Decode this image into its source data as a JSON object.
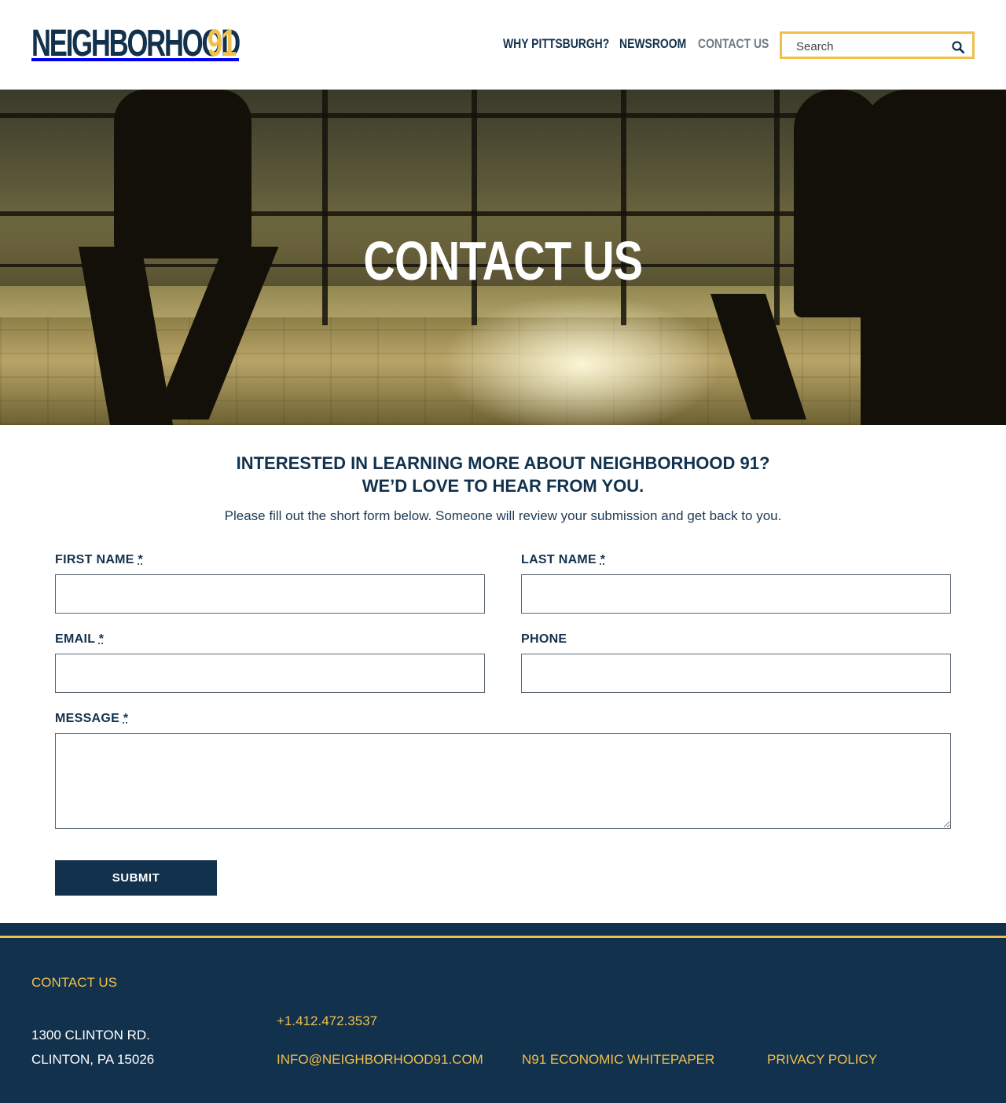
{
  "header": {
    "logo_text": "NEIGHBORHOOD",
    "logo_number": "91",
    "nav": [
      {
        "label": "WHY PITTSBURGH?"
      },
      {
        "label": "NEWSROOM"
      },
      {
        "label": "CONTACT US"
      }
    ],
    "search": {
      "placeholder": "Search",
      "value": ""
    }
  },
  "hero": {
    "title": "CONTACT US"
  },
  "intro": {
    "heading_line1": "INTERESTED IN LEARNING MORE ABOUT NEIGHBORHOOD 91?",
    "heading_line2": "WE’D LOVE TO HEAR FROM YOU.",
    "text": "Please fill out the short form below. Someone will review your submission and get back to you."
  },
  "form": {
    "first_name": {
      "label": "FIRST NAME",
      "required_mark": "*",
      "value": ""
    },
    "last_name": {
      "label": "LAST NAME",
      "required_mark": "*",
      "value": ""
    },
    "email": {
      "label": "EMAIL",
      "required_mark": "*",
      "value": ""
    },
    "phone": {
      "label": "PHONE",
      "value": ""
    },
    "message": {
      "label": "MESSAGE",
      "required_mark": "*",
      "value": ""
    },
    "submit_label": "SUBMIT"
  },
  "footer": {
    "title": "CONTACT US",
    "address_line1": "1300 CLINTON RD.",
    "address_line2": "CLINTON, PA 15026",
    "phone": "+1.412.472.3537",
    "email": "INFO@NEIGHBORHOOD91.COM",
    "whitepaper": "N91 ECONOMIC WHITEPAPER",
    "privacy": "PRIVACY POLICY"
  },
  "colors": {
    "navy": "#12314d",
    "gold": "#f0c04a",
    "nav_active": "#707a84"
  }
}
